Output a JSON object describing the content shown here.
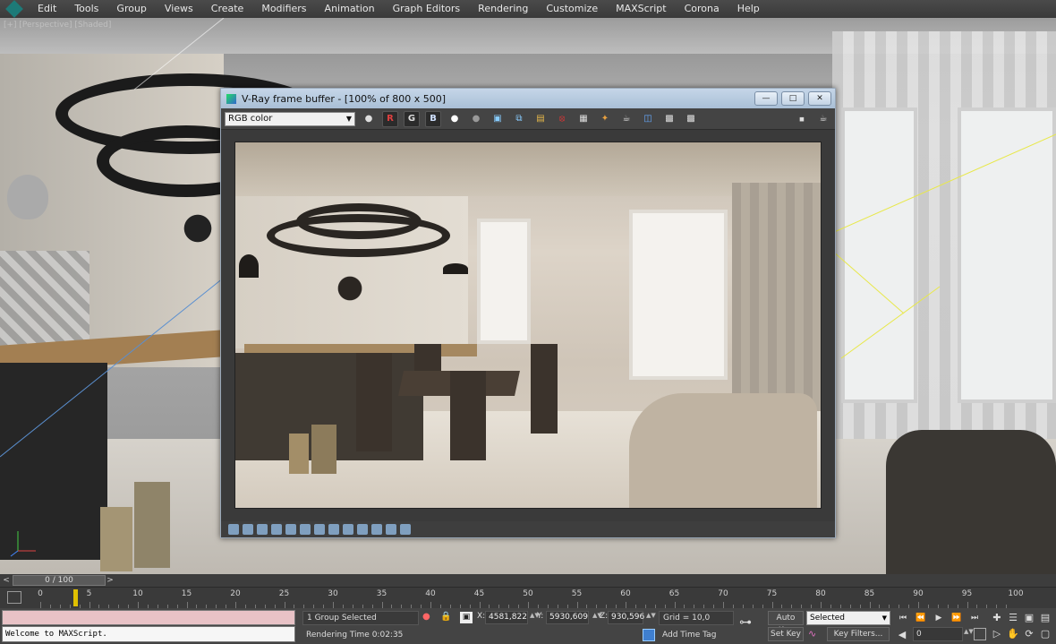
{
  "menu": {
    "items": [
      "Edit",
      "Tools",
      "Group",
      "Views",
      "Create",
      "Modifiers",
      "Animation",
      "Graph Editors",
      "Rendering",
      "Customize",
      "MAXScript",
      "Corona",
      "Help"
    ]
  },
  "viewport": {
    "label": "[+] [Perspective] [Shaded]"
  },
  "vfb": {
    "title": "V-Ray frame buffer - [100% of 800 x 500]",
    "channel": "RGB color",
    "channel_buttons": {
      "r": "R",
      "g": "G",
      "b": "B"
    }
  },
  "timeline": {
    "slider_label": "0 / 100",
    "prev": "<",
    "next": ">",
    "ticks": [
      "0",
      "5",
      "10",
      "15",
      "20",
      "25",
      "30",
      "35",
      "40",
      "45",
      "50",
      "55",
      "60",
      "65",
      "70",
      "75",
      "80",
      "85",
      "90",
      "95",
      "100"
    ]
  },
  "status": {
    "maxscript_output": "Welcome to MAXScript.",
    "selection": "1 Group Selected",
    "render_time": "Rendering Time  0:02:35",
    "x_label": "X:",
    "x_value": "4581,822",
    "y_label": "Y:",
    "y_value": "5930,609",
    "z_label": "Z:",
    "z_value": "930,596",
    "grid": "Grid = 10,0",
    "add_time_tag": "Add Time Tag",
    "auto_key": "Auto Key",
    "set_key": "Set Key",
    "selected_option": "Selected",
    "key_filters": "Key Filters...",
    "current_frame": "0"
  }
}
